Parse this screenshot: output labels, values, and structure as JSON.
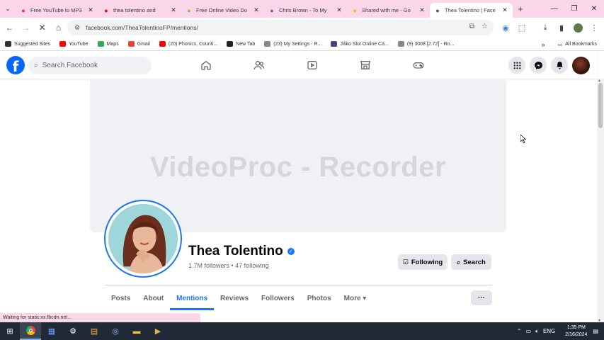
{
  "browser": {
    "tabs": [
      {
        "title": "Free YouTube to MP3",
        "color": "#e0245e",
        "icon": "download-heart-icon"
      },
      {
        "title": "thea tolentino and",
        "color": "#ff0000",
        "icon": "youtube-icon"
      },
      {
        "title": "Free Online Video Do",
        "color": "#8bc34a",
        "icon": "download-arrow-icon"
      },
      {
        "title": "Chris Brown - To My",
        "color": "#5c6bc0",
        "icon": "image-icon"
      },
      {
        "title": "Shared with me - Go",
        "color": "#fbbc04",
        "icon": "google-drive-icon"
      },
      {
        "title": "Thea Tolentino | Face",
        "color": "#555555",
        "icon": "loading-icon",
        "active": true
      }
    ],
    "url": "facebook.com/TheaTolentinoFP/mentions/",
    "bookmarks": [
      {
        "label": "Suggested Sites",
        "color": "#333333"
      },
      {
        "label": "YouTube",
        "color": "#ff0000"
      },
      {
        "label": "Maps",
        "color": "#34a853"
      },
      {
        "label": "Gmail",
        "color": "#ea4335"
      },
      {
        "label": "(20) Phonics, Counti...",
        "color": "#ff0000"
      },
      {
        "label": "New Tab",
        "color": "#222222"
      },
      {
        "label": "(23) My Settings - R...",
        "color": "#888888"
      },
      {
        "label": "Jiliko Slot Online Ca...",
        "color": "#444488"
      },
      {
        "label": "(9) 3008 [2.72] - Ro...",
        "color": "#888888"
      }
    ],
    "all_bookmarks": "All Bookmarks",
    "status_text": "Waiting for static.xx.fbcdn.net..."
  },
  "facebook": {
    "logo": "f",
    "search_placeholder": "Search Facebook",
    "profile": {
      "watermark": "VideoProc - Recorder",
      "name": "Thea Tolentino",
      "followers_line": "1.7M followers • 47 following",
      "following_label": "Following",
      "search_label": "Search",
      "tabs": [
        "Posts",
        "About",
        "Mentions",
        "Reviews",
        "Followers",
        "Photos",
        "More ▾"
      ],
      "active_tab": "Mentions",
      "more_button": "···"
    },
    "accent": "#1877f2"
  },
  "taskbar": {
    "time": "1:35 PM",
    "date": "2/16/2024"
  }
}
